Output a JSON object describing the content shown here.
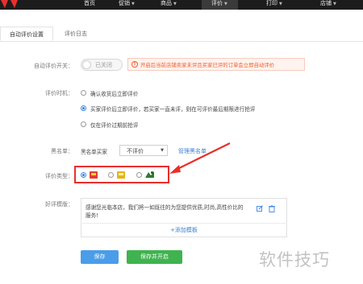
{
  "nav": {
    "items": [
      {
        "label": "首页",
        "caret": ""
      },
      {
        "label": "促销",
        "caret": "▼"
      },
      {
        "label": "商品",
        "caret": "▼"
      },
      {
        "label": "评价",
        "caret": "▼"
      },
      {
        "label": "打印",
        "caret": "▼"
      },
      {
        "label": "店铺",
        "caret": "▼"
      }
    ]
  },
  "tabs": [
    {
      "label": "自动评价设置"
    },
    {
      "label": "评价日志"
    }
  ],
  "auto_review": {
    "label": "自动评价开关：",
    "toggle_text": "已关闭",
    "warning": "开启后当前店铺卖家未评且买家已评的订单会立即自动评价"
  },
  "timing": {
    "label": "评价时机：",
    "options": [
      {
        "text": "确认收货后立即评价",
        "selected": false
      },
      {
        "text": "买家评价后立即评价，若买家一直未评，则在可评价最后期限进行抢评",
        "selected": true
      },
      {
        "text": "仅在评价过期前抢评",
        "selected": false
      }
    ]
  },
  "blacklist": {
    "label": "黑名单：",
    "prefix": "黑名单买家",
    "selected": "不评价",
    "caret": "▼",
    "manage_link": "管理黑名单"
  },
  "review_type": {
    "label": "评价类型：",
    "options": [
      {
        "icon": "good-review-icon",
        "selected": true
      },
      {
        "icon": "neutral-review-icon",
        "selected": false
      },
      {
        "icon": "bad-review-icon",
        "selected": false
      }
    ]
  },
  "template": {
    "label": "好评模版：",
    "text": "感谢您光临本店，我们将一如既往的为您提供优质,时尚,高性价比的服务!",
    "add_label": "+添加模板"
  },
  "buttons": {
    "save": "保存",
    "save_open": "保存并开启"
  },
  "watermark": "软件技巧",
  "colors": {
    "accent_blue": "#3b86e6",
    "warning_orange": "#f05c2a",
    "annotation_red": "#e8302e",
    "save_blue": "#4a9de8",
    "save_open_green": "#3fb34f"
  }
}
